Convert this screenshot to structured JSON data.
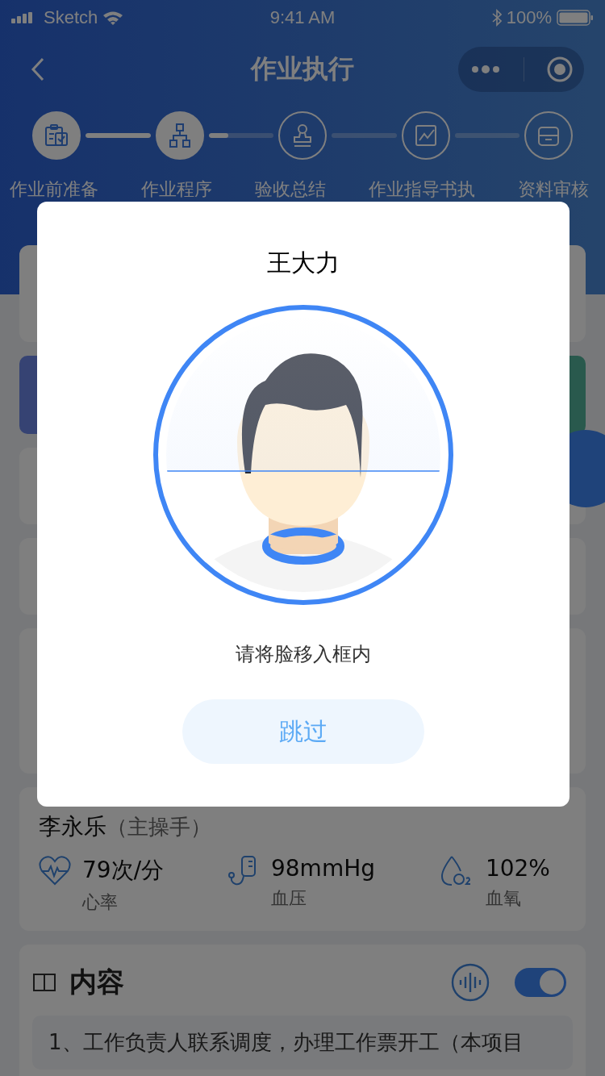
{
  "status_bar": {
    "carrier": "Sketch",
    "time": "9:41 AM",
    "battery": "100%"
  },
  "nav": {
    "title": "作业执行"
  },
  "steps": [
    {
      "label": "作业前准备",
      "done": true
    },
    {
      "label": "作业程序",
      "done": true
    },
    {
      "label": "验收总结",
      "done": false
    },
    {
      "label": "作业指导书执",
      "done": false
    },
    {
      "label": "资料审核",
      "done": false
    }
  ],
  "connectors": [
    {
      "level": 1
    },
    {
      "level": 0.3
    }
  ],
  "worker": {
    "name": "李永乐",
    "role": "（主操手）"
  },
  "vitals": [
    {
      "kind": "heart",
      "value": "79次/分",
      "label": "心率"
    },
    {
      "kind": "pressure",
      "value": "98mmHg",
      "label": "血压"
    },
    {
      "kind": "oxygen",
      "value": "102%",
      "label": "血氧"
    }
  ],
  "content": {
    "title": "内容",
    "toggle_on": true,
    "text": "1、工作负责人联系调度，办理工作票开工（本项目"
  },
  "dialog": {
    "title": "王大力",
    "hint": "请将脸移入框内",
    "skip_button": "跳过"
  }
}
